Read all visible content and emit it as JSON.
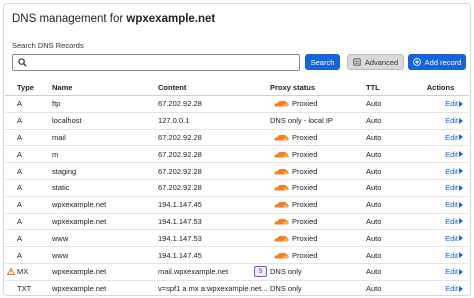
{
  "header": {
    "title_prefix": "DNS management for",
    "domain": "wpxexample.net"
  },
  "search": {
    "label": "Search DNS Records",
    "value": "",
    "placeholder": ""
  },
  "buttons": {
    "search": "Search",
    "advanced": "Advanced",
    "add_record": "Add record"
  },
  "columns": {
    "type": "Type",
    "name": "Name",
    "content": "Content",
    "proxy": "Proxy status",
    "ttl": "TTL",
    "actions": "Actions"
  },
  "colors": {
    "accent": "#1565d8",
    "cloud": "#f38020",
    "warning": "#e06a00"
  },
  "records": [
    {
      "type": "A",
      "name": "ftp",
      "content": "67.202.92.28",
      "proxied": true,
      "proxy": "Proxied",
      "ttl": "Auto",
      "action": "Edit"
    },
    {
      "type": "A",
      "name": "localhost",
      "content": "127.0.0.1",
      "proxied": false,
      "proxy": "DNS only - local IP",
      "ttl": "Auto",
      "action": "Edit"
    },
    {
      "type": "A",
      "name": "mail",
      "content": "67.202.92.28",
      "proxied": true,
      "proxy": "Proxied",
      "ttl": "Auto",
      "action": "Edit"
    },
    {
      "type": "A",
      "name": "m",
      "content": "67.202.92.28",
      "proxied": true,
      "proxy": "Proxied",
      "ttl": "Auto",
      "action": "Edit"
    },
    {
      "type": "A",
      "name": "staging",
      "content": "67.202.92.28",
      "proxied": true,
      "proxy": "Proxied",
      "ttl": "Auto",
      "action": "Edit"
    },
    {
      "type": "A",
      "name": "static",
      "content": "67.202.92.28",
      "proxied": true,
      "proxy": "Proxied",
      "ttl": "Auto",
      "action": "Edit"
    },
    {
      "type": "A",
      "name": "wpxexample.net",
      "content": "194.1.147.45",
      "proxied": true,
      "proxy": "Proxied",
      "ttl": "Auto",
      "action": "Edit"
    },
    {
      "type": "A",
      "name": "wpxexample.net",
      "content": "194.1.147.53",
      "proxied": true,
      "proxy": "Proxied",
      "ttl": "Auto",
      "action": "Edit"
    },
    {
      "type": "A",
      "name": "www",
      "content": "194.1.147.53",
      "proxied": true,
      "proxy": "Proxied",
      "ttl": "Auto",
      "action": "Edit"
    },
    {
      "type": "A",
      "name": "www",
      "content": "194.1.147.45",
      "proxied": true,
      "proxy": "Proxied",
      "ttl": "Auto",
      "action": "Edit"
    },
    {
      "type": "MX",
      "name": "wpxexample.net",
      "content": "mail.wpxexample.net",
      "badge": "5",
      "warning": true,
      "proxied": false,
      "proxy": "DNS only",
      "ttl": "Auto",
      "action": "Edit"
    },
    {
      "type": "TXT",
      "name": "wpxexample.net",
      "content": "v=spf1 a mx a:wpxexample.net...",
      "proxied": false,
      "proxy": "DNS only",
      "ttl": "Auto",
      "action": "Edit"
    }
  ]
}
